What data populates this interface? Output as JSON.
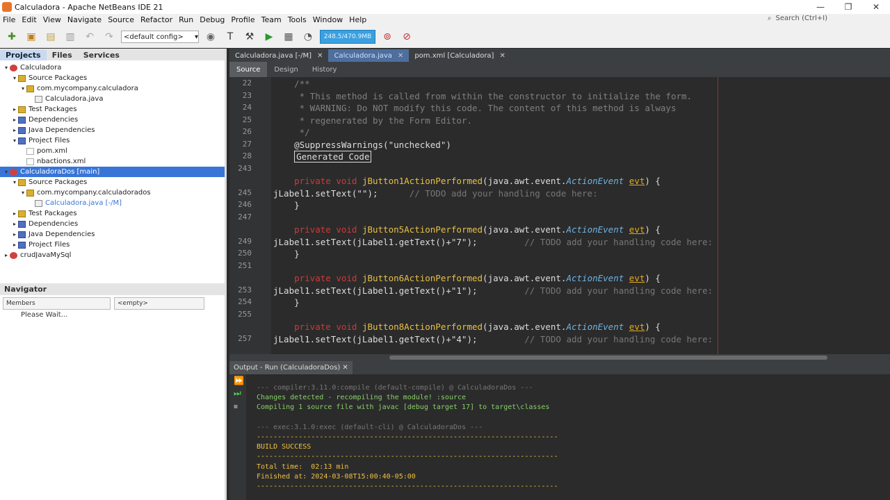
{
  "window": {
    "title": "Calculadora - Apache NetBeans IDE 21",
    "search_placeholder": "Search (Ctrl+I)"
  },
  "menu": [
    "File",
    "Edit",
    "View",
    "Navigate",
    "Source",
    "Refactor",
    "Run",
    "Debug",
    "Profile",
    "Team",
    "Tools",
    "Window",
    "Help"
  ],
  "toolbar": {
    "config": "<default config>",
    "memory": "248.5/470.9MB"
  },
  "left_tabs": [
    "Projects",
    "Files",
    "Services"
  ],
  "tree": [
    {
      "label": "Calculadora",
      "indent": 0,
      "icon": "proj",
      "tw": "▾"
    },
    {
      "label": "Source Packages",
      "indent": 1,
      "icon": "pkg",
      "tw": "▾"
    },
    {
      "label": "com.mycompany.calculadora",
      "indent": 2,
      "icon": "pkg",
      "tw": "▾"
    },
    {
      "label": "Calculadora.java",
      "indent": 3,
      "icon": "java",
      "tw": ""
    },
    {
      "label": "Test Packages",
      "indent": 1,
      "icon": "pkg",
      "tw": "▸"
    },
    {
      "label": "Dependencies",
      "indent": 1,
      "icon": "folder",
      "tw": "▸"
    },
    {
      "label": "Java Dependencies",
      "indent": 1,
      "icon": "folder",
      "tw": "▸"
    },
    {
      "label": "Project Files",
      "indent": 1,
      "icon": "folder",
      "tw": "▾"
    },
    {
      "label": "pom.xml",
      "indent": 2,
      "icon": "xml",
      "tw": ""
    },
    {
      "label": "nbactions.xml",
      "indent": 2,
      "icon": "xml",
      "tw": ""
    },
    {
      "label": "CalculadoraDos [main]",
      "indent": 0,
      "icon": "proj",
      "tw": "▾",
      "selected": true
    },
    {
      "label": "Source Packages",
      "indent": 1,
      "icon": "pkg",
      "tw": "▾"
    },
    {
      "label": "com.mycompany.calculadorados",
      "indent": 2,
      "icon": "pkg",
      "tw": "▾"
    },
    {
      "label": "Calculadora.java [-/M]",
      "indent": 3,
      "icon": "java",
      "tw": "",
      "modified": true
    },
    {
      "label": "Test Packages",
      "indent": 1,
      "icon": "pkg",
      "tw": "▸"
    },
    {
      "label": "Dependencies",
      "indent": 1,
      "icon": "folder",
      "tw": "▸"
    },
    {
      "label": "Java Dependencies",
      "indent": 1,
      "icon": "folder",
      "tw": "▸"
    },
    {
      "label": "Project Files",
      "indent": 1,
      "icon": "folder",
      "tw": "▸"
    },
    {
      "label": "crudJavaMySql",
      "indent": 0,
      "icon": "proj",
      "tw": "▸"
    }
  ],
  "navigator": {
    "title": "Navigator",
    "members": "Members",
    "filter": "<empty>",
    "status": "Please Wait..."
  },
  "editor_tabs": [
    {
      "label": "Calculadora.java [-/M]",
      "active": false
    },
    {
      "label": "Calculadora.java",
      "active": true
    },
    {
      "label": "pom.xml [Calculadora]",
      "active": false
    }
  ],
  "editor_modes": [
    "Source",
    "Design",
    "History"
  ],
  "code": [
    {
      "n": "22",
      "html": "<span class='cm'>    /**</span>"
    },
    {
      "n": "23",
      "html": "<span class='cm'>     * This method is called from within the constructor to initialize the form.</span>"
    },
    {
      "n": "24",
      "html": "<span class='cm'>     * WARNING: Do NOT modify this code. The content of this method is always</span>"
    },
    {
      "n": "25",
      "html": "<span class='cm'>     * regenerated by the Form Editor.</span>"
    },
    {
      "n": "26",
      "html": "<span class='cm'>     */</span>"
    },
    {
      "n": "27",
      "html": "<span class='an'>    @SuppressWarnings(\"unchecked\")</span>"
    },
    {
      "n": "28",
      "html": "    <span class='gen'>Generated Code</span>"
    },
    {
      "n": "243",
      "html": ""
    },
    {
      "n": "",
      "html": "    <span class='kw'>private void</span> <span class='fn'>jButton1ActionPerformed</span>(java.awt.event.<span class='ev'>ActionEvent</span> <span class='pr'>evt</span>) {"
    },
    {
      "n": "245",
      "html": "jLabel1.setText(\"\");      <span class='todo'>// TODO add your handling code here:</span>"
    },
    {
      "n": "246",
      "html": "    }"
    },
    {
      "n": "247",
      "html": ""
    },
    {
      "n": "",
      "html": "    <span class='kw'>private void</span> <span class='fn'>jButton5ActionPerformed</span>(java.awt.event.<span class='ev'>ActionEvent</span> <span class='pr'>evt</span>) {"
    },
    {
      "n": "249",
      "html": "jLabel1.setText(jLabel1.getText()+\"7\");         <span class='todo'>// TODO add your handling code here:</span>"
    },
    {
      "n": "250",
      "html": "    }"
    },
    {
      "n": "251",
      "html": ""
    },
    {
      "n": "",
      "html": "    <span class='kw'>private void</span> <span class='fn'>jButton6ActionPerformed</span>(java.awt.event.<span class='ev'>ActionEvent</span> <span class='pr'>evt</span>) {"
    },
    {
      "n": "253",
      "html": "jLabel1.setText(jLabel1.getText()+\"1\");         <span class='todo'>// TODO add your handling code here:</span>"
    },
    {
      "n": "254",
      "html": "    }"
    },
    {
      "n": "255",
      "html": ""
    },
    {
      "n": "",
      "html": "    <span class='kw'>private void</span> <span class='fn'>jButton8ActionPerformed</span>(java.awt.event.<span class='ev'>ActionEvent</span> <span class='pr'>evt</span>) {"
    },
    {
      "n": "257",
      "html": "jLabel1.setText(jLabel1.getText()+\"4\");         <span class='todo'>// TODO add your handling code here:</span>"
    }
  ],
  "output": {
    "title": "Output - Run (CalculadoraDos)",
    "lines": [
      {
        "c": "d",
        "t": "--- compiler:3.11.0:compile (default-compile) @ CalculadoraDos ---"
      },
      {
        "c": "g",
        "t": "Changes detected - recompiling the module! :source"
      },
      {
        "c": "g",
        "t": "Compiling 1 source file with javac [debug target 17] to target\\classes"
      },
      {
        "c": "g",
        "t": ""
      },
      {
        "c": "d",
        "t": "--- exec:3.1.0:exec (default-cli) @ CalculadoraDos ---"
      },
      {
        "c": "y",
        "t": "------------------------------------------------------------------------"
      },
      {
        "c": "y",
        "t": "BUILD SUCCESS"
      },
      {
        "c": "y",
        "t": "------------------------------------------------------------------------"
      },
      {
        "c": "y",
        "t": "Total time:  02:13 min"
      },
      {
        "c": "y",
        "t": "Finished at: 2024-03-08T15:00:40-05:00"
      },
      {
        "c": "y",
        "t": "------------------------------------------------------------------------"
      }
    ]
  }
}
